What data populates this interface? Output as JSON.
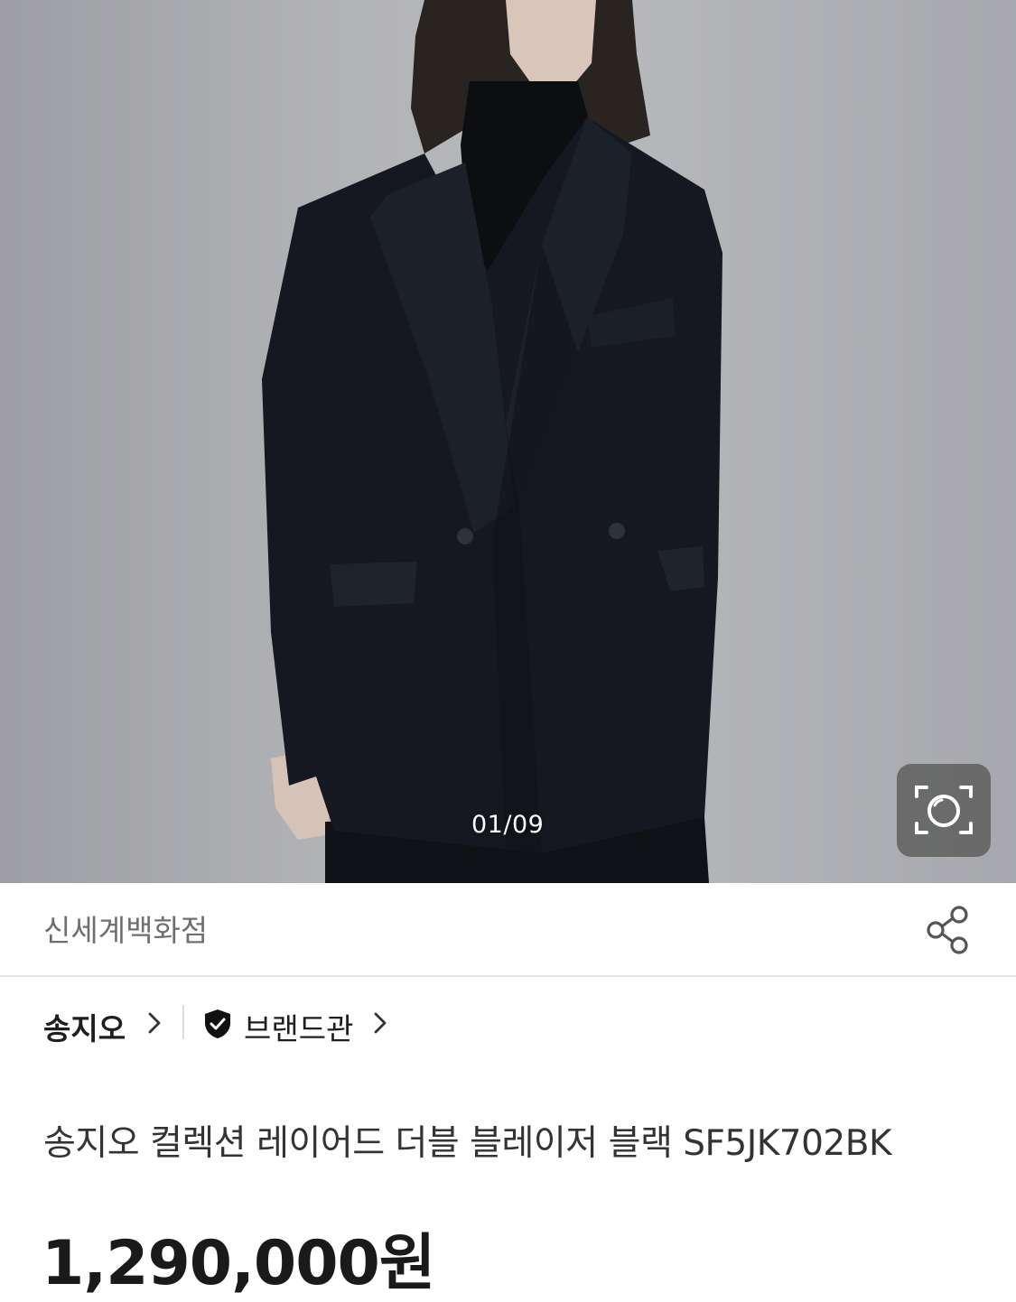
{
  "gallery": {
    "counter": "01/09",
    "image_alt": "model-wearing-black-double-breasted-blazer",
    "lens_icon": "camera-lens-search-icon"
  },
  "seller": {
    "store_name": "신세계백화점",
    "share_icon": "share-icon"
  },
  "brand": {
    "name": "송지오",
    "brand_hall_label": "브랜드관",
    "verified_icon": "shield-check-icon"
  },
  "product": {
    "title": "송지오 컬렉션 레이어드 더블 블레이저 블랙 SF5JK702BK",
    "price": "1,290,000원"
  },
  "colors": {
    "background": "#ffffff",
    "jacket": "#151820",
    "backdrop": "#b3b4b8",
    "divider": "#e5e5e5"
  }
}
